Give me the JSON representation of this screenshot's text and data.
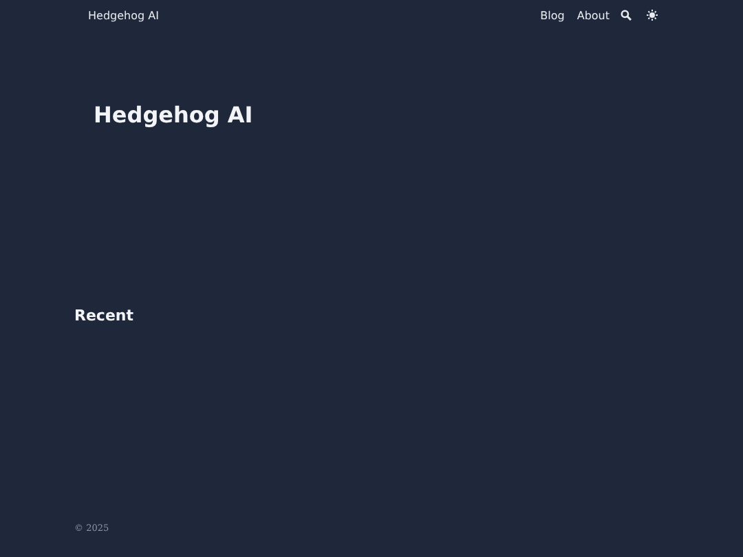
{
  "header": {
    "site_title": "Hedgehog AI",
    "nav": [
      {
        "label": "Blog"
      },
      {
        "label": "About"
      }
    ]
  },
  "hero": {
    "title": "Hedgehog AI"
  },
  "recent": {
    "heading": "Recent"
  },
  "footer": {
    "copyright": "© 2025"
  }
}
